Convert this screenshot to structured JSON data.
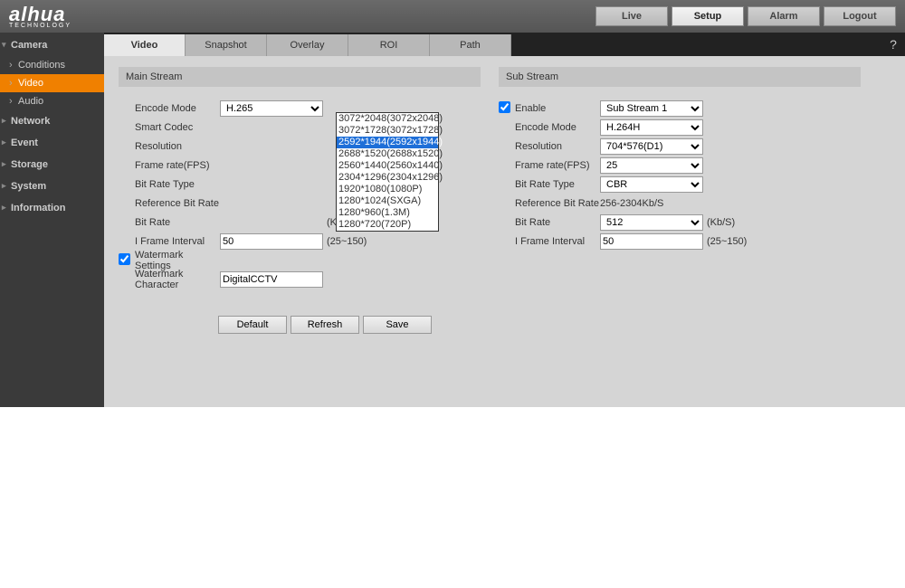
{
  "brand": {
    "name": "alhua",
    "sub": "TECHNOLOGY"
  },
  "topnav": {
    "live": "Live",
    "setup": "Setup",
    "alarm": "Alarm",
    "logout": "Logout"
  },
  "sidebar": {
    "camera": "Camera",
    "conditions": "Conditions",
    "video": "Video",
    "audio": "Audio",
    "network": "Network",
    "event": "Event",
    "storage": "Storage",
    "system": "System",
    "information": "Information"
  },
  "tabs": {
    "video": "Video",
    "snapshot": "Snapshot",
    "overlay": "Overlay",
    "roi": "ROI",
    "path": "Path"
  },
  "main": {
    "title": "Main Stream",
    "encode_mode_lbl": "Encode Mode",
    "smart_codec_lbl": "Smart Codec",
    "resolution_lbl": "Resolution",
    "fps_lbl": "Frame rate(FPS)",
    "brt_lbl": "Bit Rate Type",
    "ref_br_lbl": "Reference Bit Rate",
    "br_lbl": "Bit Rate",
    "br_unit": "(Kb/S)",
    "iframe_lbl": "I Frame Interval",
    "iframe_val": "50",
    "iframe_hint": "(25~150)",
    "wm_lbl": "Watermark Settings",
    "wmc_lbl": "Watermark Character",
    "wmc_val": "DigitalCCTV",
    "encode_mode_val": "H.265",
    "resolution_options": [
      "3072*2048(3072x2048)",
      "3072*1728(3072x1728)",
      "2592*1944(2592x1944)",
      "2688*1520(2688x1520)",
      "2560*1440(2560x1440)",
      "2304*1296(2304x1296)",
      "1920*1080(1080P)",
      "1280*1024(SXGA)",
      "1280*960(1.3M)",
      "1280*720(720P)"
    ]
  },
  "sub": {
    "title": "Sub Stream",
    "enable_lbl": "Enable",
    "enable_val": "Sub Stream 1",
    "encode_mode_lbl": "Encode Mode",
    "encode_mode_val": "H.264H",
    "resolution_lbl": "Resolution",
    "resolution_val": "704*576(D1)",
    "fps_lbl": "Frame rate(FPS)",
    "fps_val": "25",
    "brt_lbl": "Bit Rate Type",
    "brt_val": "CBR",
    "ref_br_lbl": "Reference Bit Rate",
    "ref_br_val": "256-2304Kb/S",
    "br_lbl": "Bit Rate",
    "br_val": "512",
    "br_unit": "(Kb/S)",
    "iframe_lbl": "I Frame Interval",
    "iframe_val": "50",
    "iframe_hint": "(25~150)"
  },
  "buttons": {
    "default": "Default",
    "refresh": "Refresh",
    "save": "Save"
  }
}
